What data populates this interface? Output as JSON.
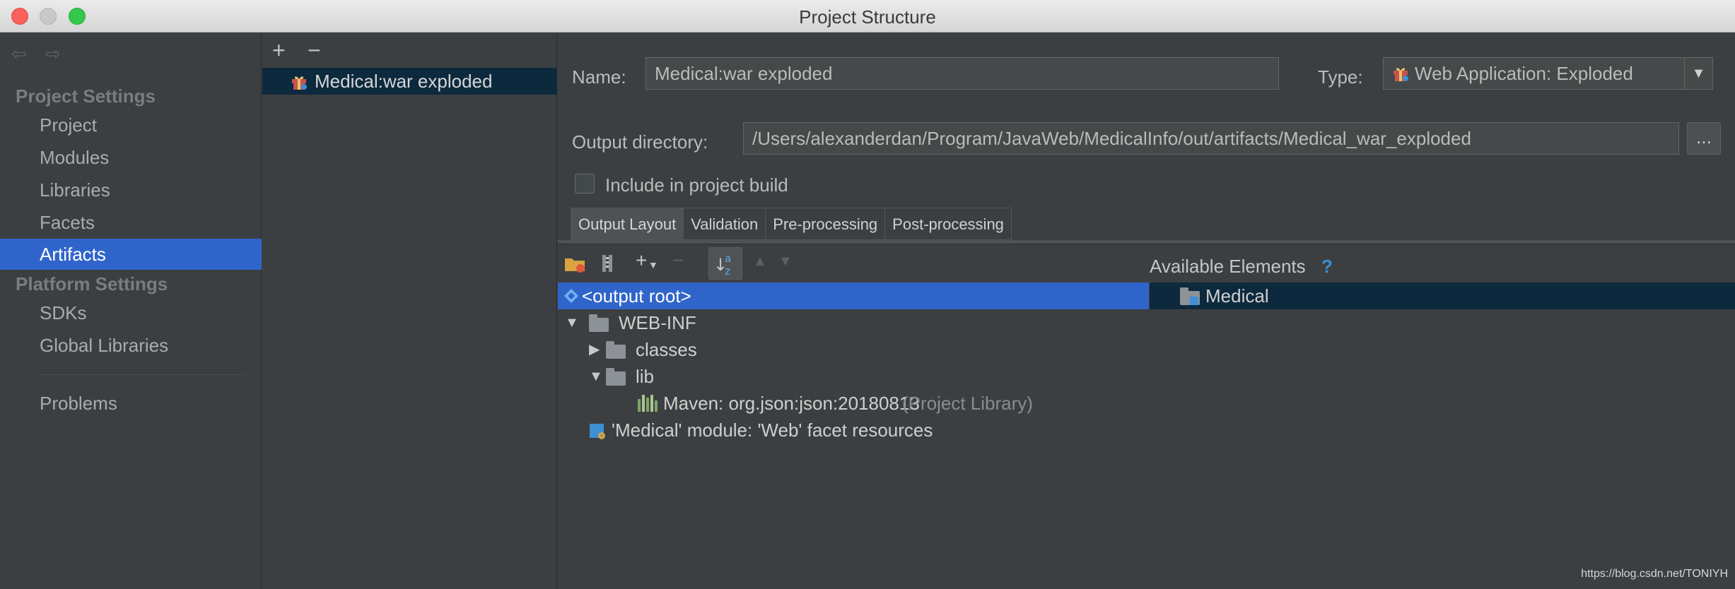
{
  "window": {
    "title": "Project Structure"
  },
  "sidebar": {
    "project_settings_header": "Project Settings",
    "project_items": [
      "Project",
      "Modules",
      "Libraries",
      "Facets",
      "Artifacts"
    ],
    "selected": "Artifacts",
    "platform_settings_header": "Platform Settings",
    "platform_items": [
      "SDKs",
      "Global Libraries"
    ],
    "problems": "Problems"
  },
  "artifacts": {
    "add_label": "+",
    "remove_label": "−",
    "items": [
      "Medical:war exploded"
    ]
  },
  "form": {
    "name_label": "Name:",
    "name_value": "Medical:war exploded",
    "type_label": "Type:",
    "type_value": "Web Application: Exploded",
    "output_label": "Output directory:",
    "output_value": "/Users/alexanderdan/Program/JavaWeb/MedicalInfo/out/artifacts/Medical_war_exploded",
    "browse_label": "...",
    "include_label": "Include in project build",
    "include_checked": false
  },
  "tabs": [
    "Output Layout",
    "Validation",
    "Pre-processing",
    "Post-processing"
  ],
  "active_tab": "Output Layout",
  "layout_toolbar": {
    "add": "+",
    "remove": "−"
  },
  "tree": {
    "output_root": "<output root>",
    "web_inf": "WEB-INF",
    "classes": "classes",
    "lib": "lib",
    "maven_lib": "Maven: org.json:json:20180813",
    "maven_lib_suffix": "(Project Library)",
    "module_resources": "'Medical' module: 'Web' facet resources"
  },
  "available": {
    "header": "Available Elements",
    "help": "?",
    "items": [
      "Medical"
    ]
  },
  "watermark": "https://blog.csdn.net/TONIYH",
  "colors": {
    "selection": "#2f65ca",
    "background": "#3c3f41",
    "inactive_selection": "#0d293e"
  }
}
